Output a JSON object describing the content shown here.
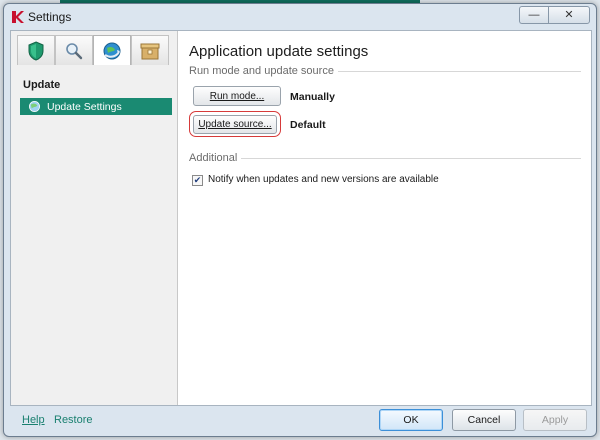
{
  "window": {
    "title": "Settings",
    "minimize_glyph": "—",
    "close_glyph": "✕"
  },
  "sidebar": {
    "tabs": [
      {
        "name": "protection-tab",
        "icon": "shield-icon"
      },
      {
        "name": "scan-tab",
        "icon": "magnifier-icon"
      },
      {
        "name": "update-tab",
        "icon": "globe-icon",
        "active": true
      },
      {
        "name": "options-tab",
        "icon": "box-icon"
      }
    ],
    "section_heading": "Update",
    "items": [
      {
        "label": "Update Settings",
        "icon": "globe-icon",
        "selected": true
      }
    ]
  },
  "main": {
    "title": "Application update settings",
    "run_mode_group": "Run mode and update source",
    "run_mode_button": "Run mode...",
    "run_mode_value": "Manually",
    "update_source_button": "Update source...",
    "update_source_value": "Default",
    "additional_group": "Additional",
    "notify_checkbox": {
      "label": "Notify when updates and new versions are available",
      "checked": true
    }
  },
  "footer": {
    "help_link": "Help",
    "restore_link": "Restore",
    "ok_button": "OK",
    "cancel_button": "Cancel",
    "apply_button": "Apply"
  },
  "colors": {
    "accent": "#1a8a72",
    "highlight_ring": "#d63a3a",
    "link": "#1a8070"
  }
}
